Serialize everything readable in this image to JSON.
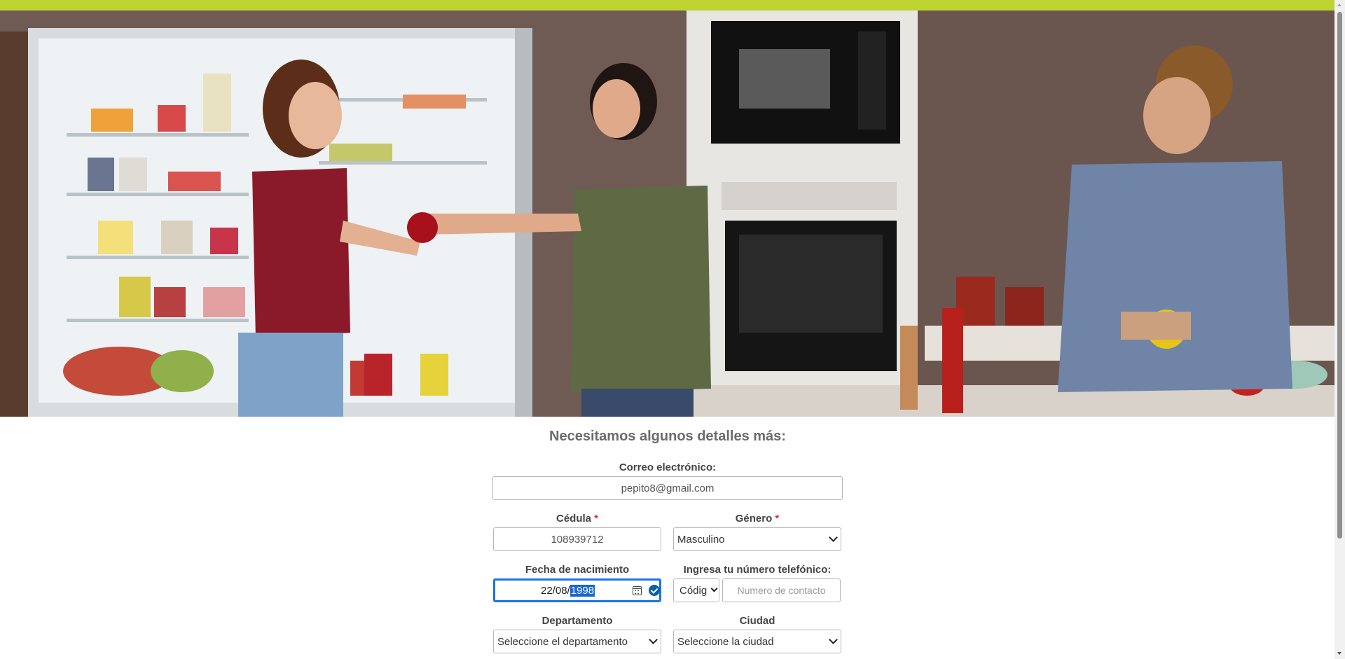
{
  "form": {
    "title": "Necesitamos algunos detalles más:",
    "email": {
      "label": "Correo electrónico:",
      "value": "pepito8@gmail.com"
    },
    "cedula": {
      "label": "Cédula",
      "required_mark": "*",
      "value": "108939712"
    },
    "genero": {
      "label": "Género",
      "required_mark": "*",
      "value": "Masculino"
    },
    "fecha": {
      "label": "Fecha de nacimiento",
      "day_month": "22/08/",
      "year_selected": "1998"
    },
    "telefono": {
      "label": "Ingresa tu número telefónico:",
      "code_value": "Códig",
      "placeholder": "Numero de contacto"
    },
    "departamento": {
      "label": "Departamento",
      "value": "Seleccione el departamento"
    },
    "ciudad": {
      "label": "Ciudad",
      "value": "Seleccione la ciudad"
    }
  },
  "colors": {
    "top_bar": "#bcd332",
    "focus": "#1a73e8"
  },
  "icons": [
    "calendar-icon",
    "check-circle-icon",
    "chevron-down-icon"
  ]
}
